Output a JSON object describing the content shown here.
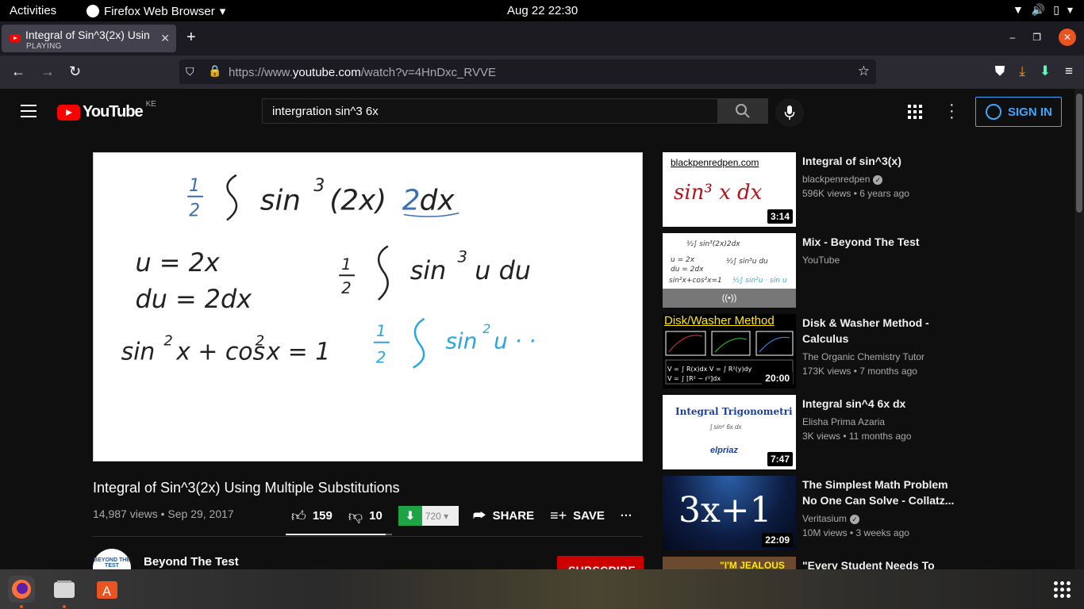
{
  "topbar": {
    "activities": "Activities",
    "app": "Firefox Web Browser",
    "clock": "Aug 22  22:30"
  },
  "tab": {
    "title": "Integral of Sin^3(2x) Usin",
    "status": "PLAYING"
  },
  "address": {
    "url_prefix": "https://www.",
    "url_domain": "youtube.com",
    "url_path": "/watch?v=4HnDxc_RVVE"
  },
  "youtube": {
    "logo_text": "YouTube",
    "country": "KE",
    "search_query": "intergration sin^3 6x",
    "sign_in": "SIGN IN"
  },
  "video": {
    "title": "Integral of Sin^3(2x) Using Multiple Substitutions",
    "meta": "14,987 views • Sep 29, 2017",
    "likes": "159",
    "dislikes": "10",
    "quality": "720",
    "share": "SHARE",
    "save": "SAVE",
    "like_ratio": 0.94,
    "channel": "Beyond The Test",
    "channel_avatar_text": "BEYOND THE TEST",
    "subscribe": "SUBSCRIBE"
  },
  "related": [
    {
      "title": "Integral of sin^3(x)",
      "channel": "blackpenredpen",
      "verified": true,
      "stats": "596K views • 6 years ago",
      "duration": "3:14",
      "thumb_text": "blackpenredpen.com",
      "thumb_formula": "sin³ x dx"
    },
    {
      "title": "Mix - Beyond The Test",
      "channel": "YouTube",
      "verified": false,
      "stats": "",
      "duration": "",
      "thumb_text": "((•))"
    },
    {
      "title": "Disk & Washer Method - Calculus",
      "channel": "The Organic Chemistry Tutor",
      "verified": false,
      "stats": "173K views • 7 months ago",
      "duration": "20:00",
      "thumb_text": "Disk/Washer Method"
    },
    {
      "title": "Integral sin^4 6x dx",
      "channel": "Elisha Prima Azaria",
      "verified": false,
      "stats": "3K views • 11 months ago",
      "duration": "7:47",
      "thumb_text": "Integral Trigonometri",
      "thumb_sub": "elpriaz"
    },
    {
      "title": "The Simplest Math Problem No One Can Solve - Collatz...",
      "channel": "Veritasium",
      "verified": true,
      "stats": "10M views • 3 weeks ago",
      "duration": "22:09",
      "thumb_text": "3x+1"
    },
    {
      "title": "\"Every Student Needs To",
      "channel": "",
      "verified": false,
      "stats": "",
      "duration": "",
      "thumb_text": "\"I'M JEALOUS"
    }
  ],
  "colors": {
    "yt_bg": "#0f0f0f",
    "accent_blue": "#3ea6ff",
    "yt_red": "#ff0000",
    "subscribe_red": "#cc0000",
    "ubuntu_orange": "#e95420",
    "download_green": "#1ea345"
  }
}
